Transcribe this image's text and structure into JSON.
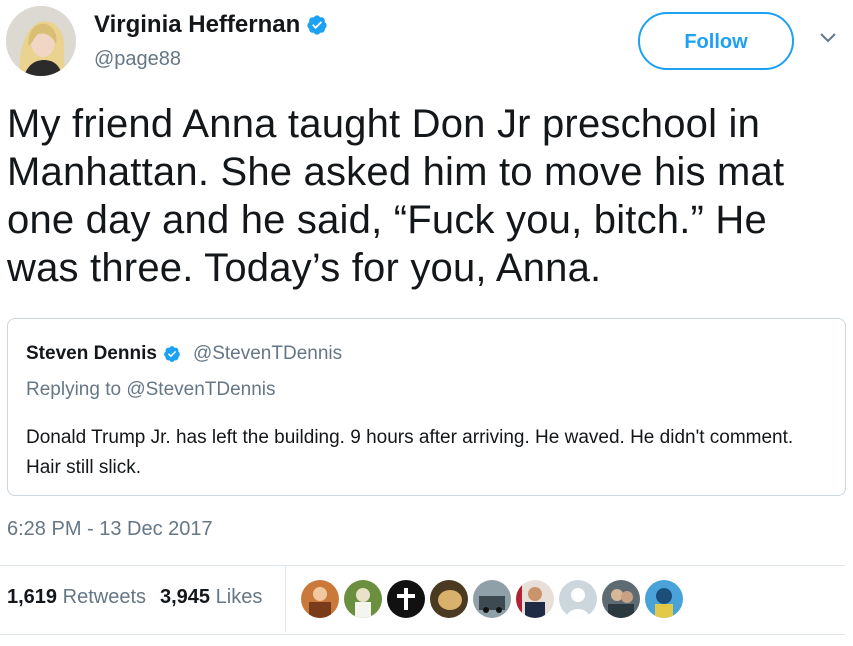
{
  "author": {
    "name": "Virginia Heffernan",
    "handle": "@page88",
    "verified_icon": "verified-badge-icon"
  },
  "actions": {
    "follow_label": "Follow",
    "more_icon": "chevron-down-icon"
  },
  "tweet": {
    "text": "My friend Anna taught Don Jr preschool in Manhattan. She asked him to move his mat one day and he said, “Fuck you, bitch.” He was three. Today’s for you, Anna."
  },
  "quoted_tweet": {
    "name": "Steven Dennis",
    "handle": "@StevenTDennis",
    "replying_to": "Replying to @StevenTDennis",
    "text": "Donald Trump Jr. has left the building. 9 hours after arriving. He waved. He didn't comment. Hair still slick."
  },
  "timestamp": "6:28 PM - 13 Dec 2017",
  "stats": {
    "retweets_count": "1,619",
    "retweets_label": "Retweets",
    "likes_count": "3,945",
    "likes_label": "Likes"
  },
  "colors": {
    "accent": "#1da1f2",
    "secondary_text": "#657786",
    "border": "#e1e8ed"
  }
}
